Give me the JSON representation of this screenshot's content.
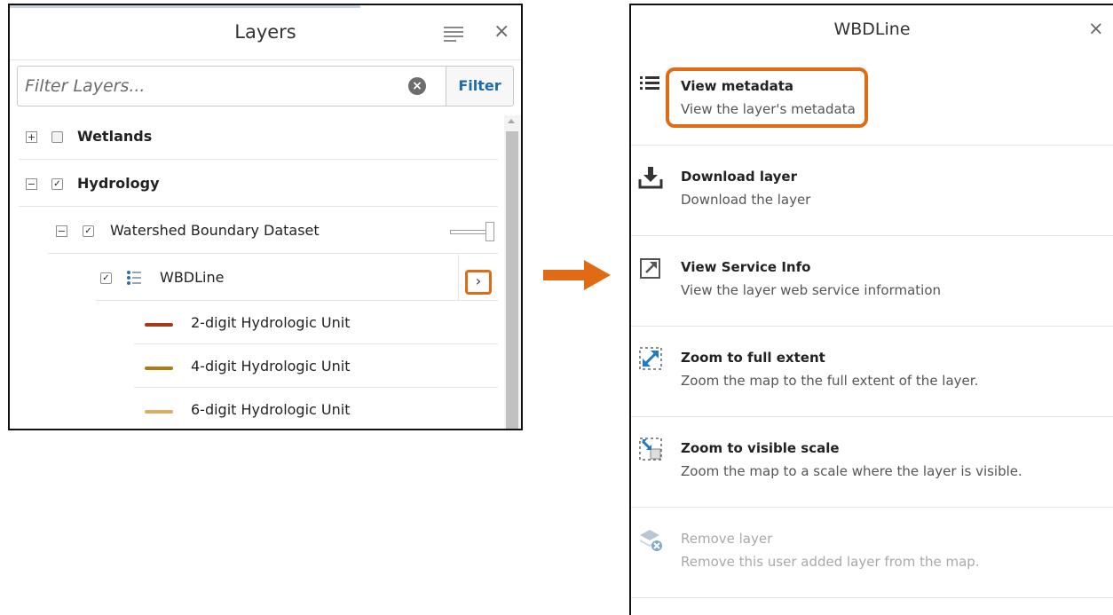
{
  "layers_panel": {
    "title": "Layers",
    "close_glyph": "×",
    "filter_placeholder": "Filter Layers...",
    "filter_button": "Filter",
    "clear_glyph": "×",
    "tree": {
      "wetlands": {
        "label": "Wetlands",
        "toggle": "+",
        "checked": false
      },
      "hydrology": {
        "label": "Hydrology",
        "toggle": "−",
        "checked": true
      },
      "watershed": {
        "label": "Watershed Boundary Dataset",
        "toggle": "−",
        "checked": true
      },
      "wbdline": {
        "label": "WBDLine",
        "checked": true,
        "expand_glyph": "›"
      },
      "legend": [
        {
          "label": "2-digit Hydrologic Unit",
          "color": "#a63a16"
        },
        {
          "label": "4-digit Hydrologic Unit",
          "color": "#b07a10"
        },
        {
          "label": "6-digit Hydrologic Unit",
          "color": "#d9ad63"
        }
      ]
    }
  },
  "options_panel": {
    "title": "WBDLine",
    "close_glyph": "×",
    "items": [
      {
        "icon": "list-icon",
        "title": "View metadata",
        "subtitle": "View the layer's metadata"
      },
      {
        "icon": "download-icon",
        "title": "Download layer",
        "subtitle": "Download the layer"
      },
      {
        "icon": "external-link-icon",
        "title": "View Service Info",
        "subtitle": "View the layer web service information"
      },
      {
        "icon": "full-extent-icon",
        "title": "Zoom to full extent",
        "subtitle": "Zoom the map to the full extent of the layer."
      },
      {
        "icon": "visible-scale-icon",
        "title": "Zoom to visible scale",
        "subtitle": "Zoom the map to a scale where the layer is visible."
      },
      {
        "icon": "remove-layer-icon",
        "title": "Remove layer",
        "subtitle": "Remove this user added layer from the map."
      }
    ]
  },
  "colors": {
    "accent_orange": "#e06b14",
    "filter_blue": "#1e6ba8"
  }
}
